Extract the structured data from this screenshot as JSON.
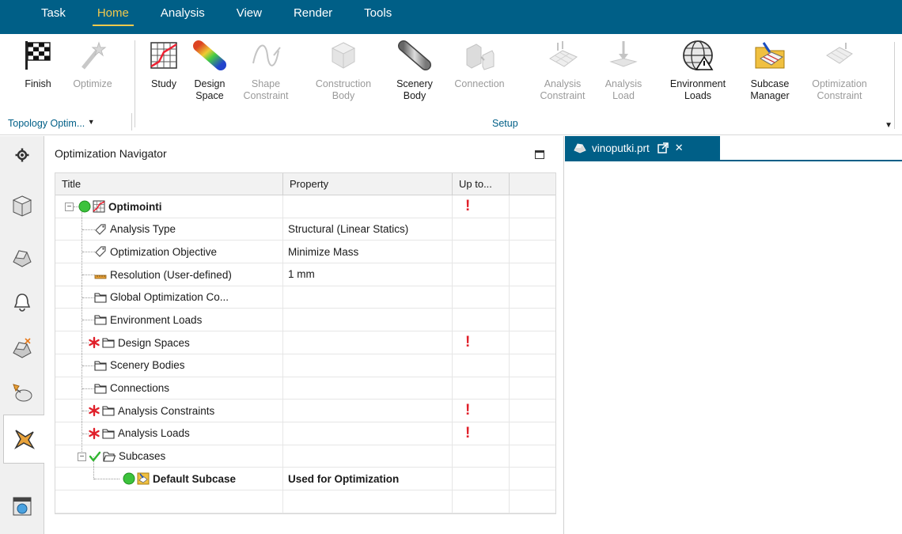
{
  "menu": {
    "tabs": [
      {
        "label": "Task"
      },
      {
        "label": "Home"
      },
      {
        "label": "Analysis"
      },
      {
        "label": "View"
      },
      {
        "label": "Render"
      },
      {
        "label": "Tools"
      }
    ],
    "active_tab": "Home"
  },
  "ribbon": {
    "buttons": {
      "finish": {
        "line1": "Finish",
        "line2": ""
      },
      "optimize": {
        "line1": "Optimize",
        "line2": ""
      },
      "study": {
        "line1": "Study",
        "line2": ""
      },
      "design_space": {
        "line1": "Design",
        "line2": "Space"
      },
      "shape_constraint": {
        "line1": "Shape",
        "line2": "Constraint"
      },
      "construction_body": {
        "line1": "Construction",
        "line2": "Body"
      },
      "scenery_body": {
        "line1": "Scenery",
        "line2": "Body"
      },
      "connection": {
        "line1": "Connection",
        "line2": ""
      },
      "analysis_constraint": {
        "line1": "Analysis",
        "line2": "Constraint"
      },
      "analysis_load": {
        "line1": "Analysis",
        "line2": "Load"
      },
      "environment_loads": {
        "line1": "Environment",
        "line2": "Loads"
      },
      "subcase_manager": {
        "line1": "Subcase",
        "line2": "Manager"
      },
      "optimization_constraint": {
        "line1": "Optimization",
        "line2": "Constraint"
      }
    },
    "groups": {
      "topology": "Topology Optim...",
      "setup": "Setup"
    }
  },
  "navigator": {
    "title": "Optimization Navigator",
    "columns": {
      "title": "Title",
      "property": "Property",
      "up_to_date": "Up to..."
    },
    "rows": [
      {
        "title": "Optimointi",
        "property": "",
        "flag": "!"
      },
      {
        "title": "Analysis Type",
        "property": "Structural (Linear Statics)",
        "flag": ""
      },
      {
        "title": "Optimization Objective",
        "property": "Minimize Mass",
        "flag": ""
      },
      {
        "title": "Resolution (User-defined)",
        "property": "1 mm",
        "flag": ""
      },
      {
        "title": "Global Optimization Co...",
        "property": "",
        "flag": ""
      },
      {
        "title": "Environment Loads",
        "property": "",
        "flag": ""
      },
      {
        "title": "Design Spaces",
        "property": "",
        "flag": "!"
      },
      {
        "title": "Scenery Bodies",
        "property": "",
        "flag": ""
      },
      {
        "title": "Connections",
        "property": "",
        "flag": ""
      },
      {
        "title": "Analysis Constraints",
        "property": "",
        "flag": "!"
      },
      {
        "title": "Analysis Loads",
        "property": "",
        "flag": "!"
      },
      {
        "title": "Subcases",
        "property": "",
        "flag": ""
      },
      {
        "title": "Default Subcase",
        "property": "Used for Optimization",
        "flag": ""
      }
    ],
    "expander_minus": "−"
  },
  "document": {
    "tab_label": "vinoputki.prt",
    "close_glyph": "✕"
  },
  "colors": {
    "menubar": "#005f87",
    "active_tab": "#f2c94c",
    "error": "#e0202a",
    "ok_check": "#2fb52f",
    "status_green": "#3cc23c"
  }
}
